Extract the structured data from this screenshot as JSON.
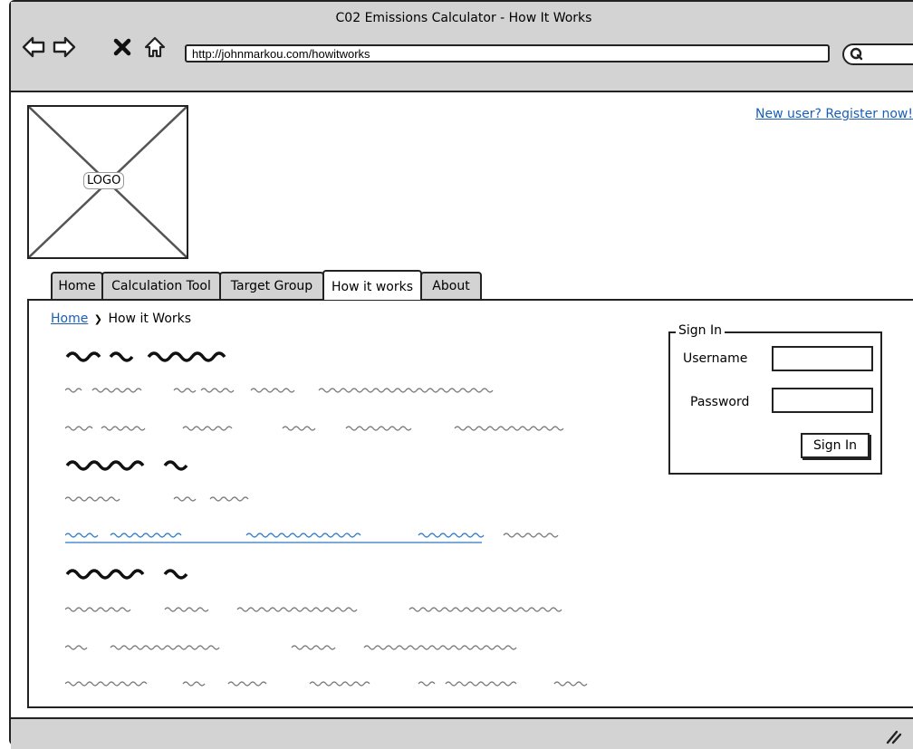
{
  "window": {
    "title": "C02 Emissions Calculator - How It Works",
    "url": "http://johnmarkou.com/howitworks"
  },
  "header": {
    "logo_label": "LOGO",
    "register_link": "New user? Register now!"
  },
  "tabs": [
    {
      "label": "Home"
    },
    {
      "label": "Calculation Tool"
    },
    {
      "label": "Target Group"
    },
    {
      "label": "How it works",
      "active": true
    },
    {
      "label": "About"
    }
  ],
  "breadcrumb": {
    "home": "Home",
    "separator": "❯",
    "current": "How it Works"
  },
  "signin": {
    "title": "Sign In",
    "username_label": "Username",
    "password_label": "Password",
    "button_label": "Sign In"
  },
  "colors": {
    "chrome": "#d3d3d3",
    "link": "#1a5fb4",
    "border": "#222222"
  }
}
